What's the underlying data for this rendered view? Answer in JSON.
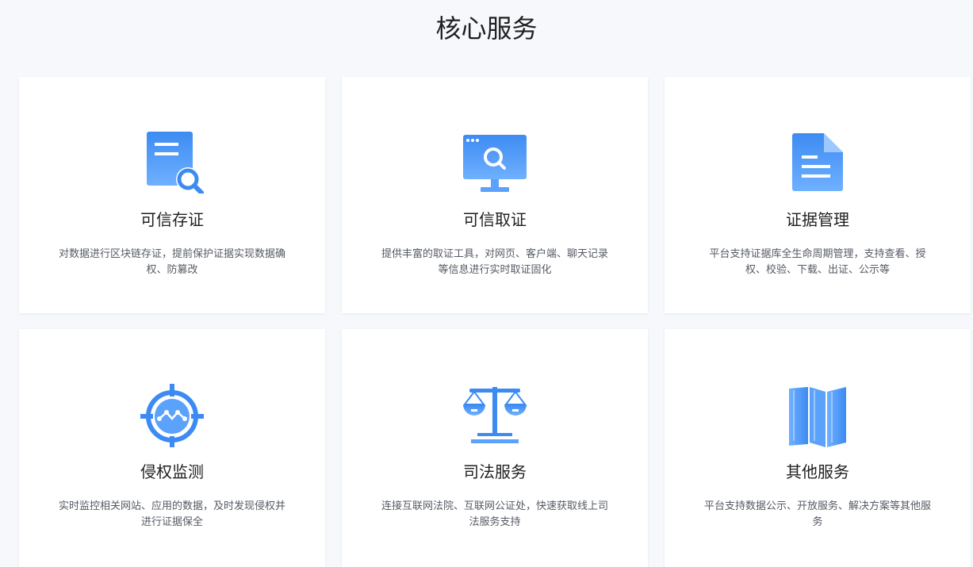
{
  "section": {
    "title": "核心服务"
  },
  "cards": [
    {
      "title": "可信存证",
      "desc": "对数据进行区块链存证，提前保护证据实现数据确权、防篡改",
      "icon": "document-search-icon"
    },
    {
      "title": "可信取证",
      "desc": "提供丰富的取证工具，对网页、客户端、聊天记录等信息进行实时取证固化",
      "icon": "monitor-search-icon"
    },
    {
      "title": "证据管理",
      "desc": "平台支持证据库全生命周期管理，支持查看、授权、校验、下载、出证、公示等",
      "icon": "file-icon"
    },
    {
      "title": "侵权监测",
      "desc": "实时监控相关网站、应用的数据，及时发现侵权并进行证据保全",
      "icon": "target-monitor-icon"
    },
    {
      "title": "司法服务",
      "desc": "连接互联网法院、互联网公证处，快速获取线上司法服务支持",
      "icon": "scales-icon"
    },
    {
      "title": "其他服务",
      "desc": "平台支持数据公示、开放服务、解决方案等其他服务",
      "icon": "map-icon"
    }
  ],
  "colors": {
    "accent": "#3d8bf2",
    "accent_light": "#6fb0ff",
    "background": "#f6f8fb"
  }
}
